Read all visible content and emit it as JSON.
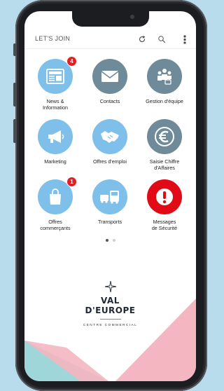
{
  "header": {
    "title": "LET'S JOIN",
    "refresh_icon": "refresh-icon",
    "search_icon": "search-icon",
    "menu_icon": "more-vertical-icon"
  },
  "tiles": [
    {
      "label": "News &\nInformation",
      "icon": "newspaper-icon",
      "color": "#7fc0ea",
      "badge": "4"
    },
    {
      "label": "Contacts",
      "icon": "envelope-icon",
      "color": "#6f8a98"
    },
    {
      "label": "Gestion d'équipe",
      "icon": "team-lock-icon",
      "color": "#6f8a98"
    },
    {
      "label": "Marketing",
      "icon": "megaphone-icon",
      "color": "#7fc0ea"
    },
    {
      "label": "Offres d'emploi",
      "icon": "handshake-icon",
      "color": "#7fc0ea"
    },
    {
      "label": "Saisie Chiffre\nd'Affaires",
      "icon": "euro-icon",
      "color": "#6f8a98"
    },
    {
      "label": "Offres\ncommerçants",
      "icon": "shopping-bag-icon",
      "color": "#7fc0ea",
      "badge": "1"
    },
    {
      "label": "Transports",
      "icon": "transport-icon",
      "color": "#7fc0ea"
    },
    {
      "label": "Messages\nde Sécurité",
      "icon": "alert-icon",
      "color": "#e10b17"
    }
  ],
  "pagination": {
    "pages": 2,
    "active": 1
  },
  "footer": {
    "logo_line1": "VAL",
    "logo_line2": "D'EUROPE",
    "logo_tagline": "CENTRE COMMERCIAL",
    "logo_icon": "star-sparkle-icon"
  },
  "colors": {
    "accent_blue": "#7fc0ea",
    "slate": "#6f8a98",
    "alert_red": "#e10b17",
    "background": "#b9dcec",
    "pink": "#f4b6c0",
    "mint": "#9fd6da"
  }
}
